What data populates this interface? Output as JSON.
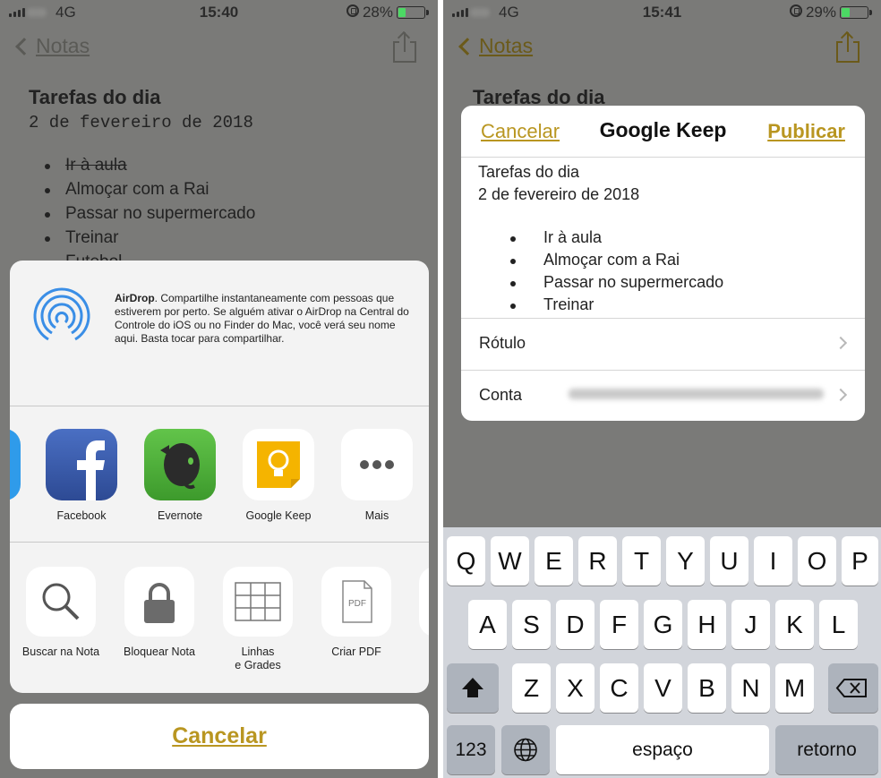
{
  "left": {
    "status": {
      "network": "4G",
      "time": "15:40",
      "battery": "28%",
      "battery_level": 0.28
    },
    "nav": {
      "back_label": "Notas"
    },
    "note": {
      "title": "Tarefas do dia",
      "date": "2 de fevereiro de 2018",
      "items": [
        "Ir à aula",
        "Almoçar com a Rai",
        "Passar no supermercado",
        "Treinar",
        "Futebol"
      ]
    },
    "airdrop": {
      "title": "AirDrop",
      "text": ". Compartilhe instantaneamente com pessoas que estiverem por perto. Se alguém ativar o AirDrop na Central do Controle do iOS ou no Finder do Mac, você verá seu nome aqui. Basta tocar para compartilhar."
    },
    "apps": [
      "Facebook",
      "Evernote",
      "Google Keep",
      "Mais"
    ],
    "actions": {
      "search": "Buscar na Nota",
      "lock": "Bloquear Nota",
      "lines1": "Linhas",
      "lines2": "e Grades",
      "pdf": "Criar PDF",
      "pdf_icon_text": "PDF"
    },
    "cancel_label": "Cancelar"
  },
  "right": {
    "status": {
      "network": "4G",
      "time": "15:41",
      "battery": "29%",
      "battery_level": 0.29
    },
    "nav": {
      "back_label": "Notas"
    },
    "note": {
      "title": "Tarefas do dia"
    },
    "dialog": {
      "cancel": "Cancelar",
      "title": "Google Keep",
      "publish": "Publicar",
      "body_title": "Tarefas do dia",
      "body_date": "2 de fevereiro de 2018",
      "items": [
        "Ir à aula",
        "Almoçar com a Rai",
        "Passar no supermercado",
        "Treinar"
      ],
      "label_row": "Rótulo",
      "account_row": "Conta"
    },
    "keyboard": {
      "row1": [
        "Q",
        "W",
        "E",
        "R",
        "T",
        "Y",
        "U",
        "I",
        "O",
        "P"
      ],
      "row2": [
        "A",
        "S",
        "D",
        "F",
        "G",
        "H",
        "J",
        "K",
        "L"
      ],
      "row3": [
        "Z",
        "X",
        "C",
        "V",
        "B",
        "N",
        "M"
      ],
      "numbers": "123",
      "space": "espaço",
      "return": "retorno"
    }
  },
  "colors": {
    "accent": "#b99621",
    "dim": "#7a7a78",
    "keyboard": "#d2d5db"
  }
}
